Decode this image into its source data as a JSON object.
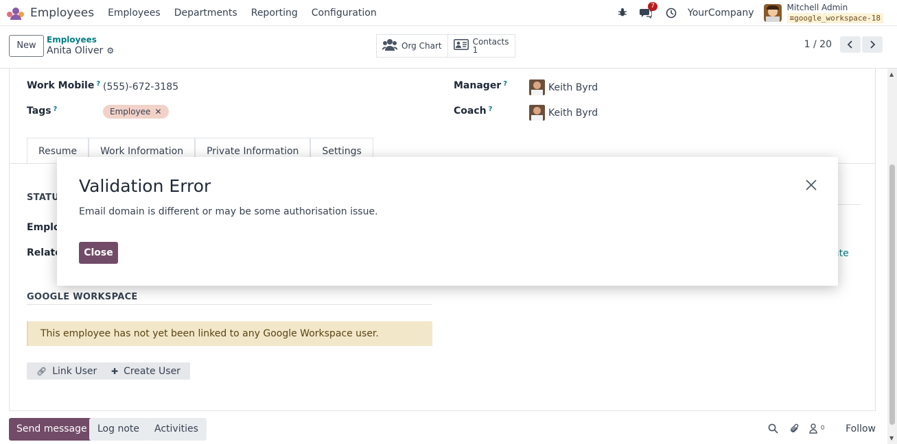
{
  "navbar": {
    "app_name": "Employees",
    "menu": [
      "Employees",
      "Departments",
      "Reporting",
      "Configuration"
    ],
    "messages_badge": "7",
    "company": "YourCompany",
    "user_name": "Mitchell Admin",
    "db_name": "google_workspace-18"
  },
  "control": {
    "new_label": "New",
    "breadcrumb_parent": "Employees",
    "breadcrumb_current": "Anita Oliver",
    "org_chart_label": "Org Chart",
    "contacts_label": "Contacts",
    "contacts_count": "1",
    "pager": "1 / 20"
  },
  "form": {
    "work_mobile_label": "Work Mobile",
    "work_mobile_value": "(555)-672-3185",
    "tags_label": "Tags",
    "tag_value": "Employee",
    "manager_label": "Manager",
    "manager_value": "Keith Byrd",
    "coach_label": "Coach",
    "coach_value": "Keith Byrd",
    "help_mark": "?",
    "tabs": [
      "Resume",
      "Work Information",
      "Private Information",
      "Settings"
    ],
    "status_title_partial": "STATUS",
    "employee_partial": "Employ",
    "related_partial": "Related",
    "create_partial": "ate",
    "google_title": "GOOGLE WORKSPACE",
    "alert_text": "This employee has not yet been linked to any Google Workspace user.",
    "link_user_label": "Link User",
    "create_user_label": "Create User"
  },
  "chatter": {
    "send_message": "Send message",
    "log_note": "Log note",
    "activities": "Activities",
    "followers_count": "0",
    "follow": "Follow"
  },
  "modal": {
    "title": "Validation Error",
    "message": "Email domain is different or may be some authorisation issue.",
    "close_label": "Close"
  },
  "colors": {
    "brand": "#714b67",
    "link": "#017e84",
    "alert_bg": "#f3e7c9",
    "tag_bg": "#f2d2c8"
  }
}
